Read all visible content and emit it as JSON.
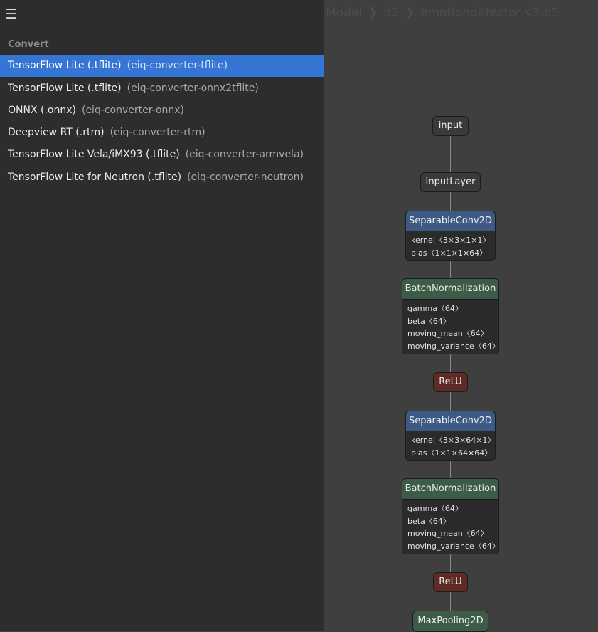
{
  "sidebar": {
    "section_title": "Convert",
    "items": [
      {
        "label": "TensorFlow Lite (.tflite)",
        "ident": "(eiq-converter-tflite)"
      },
      {
        "label": "TensorFlow Lite (.tflite)",
        "ident": "(eiq-converter-onnx2tflite)"
      },
      {
        "label": "ONNX (.onnx)",
        "ident": "(eiq-converter-onnx)"
      },
      {
        "label": "Deepview RT (.rtm)",
        "ident": "(eiq-converter-rtm)"
      },
      {
        "label": "TensorFlow Lite Vela/iMX93 (.tflite)",
        "ident": "(eiq-converter-armvela)"
      },
      {
        "label": "TensorFlow Lite for Neutron (.tflite)",
        "ident": "(eiq-converter-neutron)"
      }
    ],
    "menu_icon": "hamburger-icon"
  },
  "breadcrumb": {
    "items": [
      "Model",
      "h5",
      "emotiondetector v3.h5"
    ],
    "separator": "❯"
  },
  "graph": {
    "nodes": [
      {
        "name": "input"
      },
      {
        "name": "InputLayer"
      },
      {
        "name": "SeparableConv2D",
        "attrs": [
          "kernel〈3×3×1×1〉",
          "bias〈1×1×1×64〉"
        ]
      },
      {
        "name": "BatchNormalization",
        "attrs": [
          "gamma〈64〉",
          "beta〈64〉",
          "moving_mean〈64〉",
          "moving_variance〈64〉"
        ]
      },
      {
        "name": "ReLU"
      },
      {
        "name": "SeparableConv2D",
        "attrs": [
          "kernel〈3×3×64×1〉",
          "bias〈1×1×64×64〉"
        ]
      },
      {
        "name": "BatchNormalization",
        "attrs": [
          "gamma〈64〉",
          "beta〈64〉",
          "moving_mean〈64〉",
          "moving_variance〈64〉"
        ]
      },
      {
        "name": "ReLU"
      },
      {
        "name": "MaxPooling2D"
      }
    ]
  },
  "colors": {
    "selected": "#3575d3",
    "sidebar_bg": "#2d2d2d",
    "canvas_bg": "#3f3f3f",
    "conv_header": "#3d5a85",
    "norm_header": "#3c5c47",
    "relu": "#5d2a24"
  }
}
